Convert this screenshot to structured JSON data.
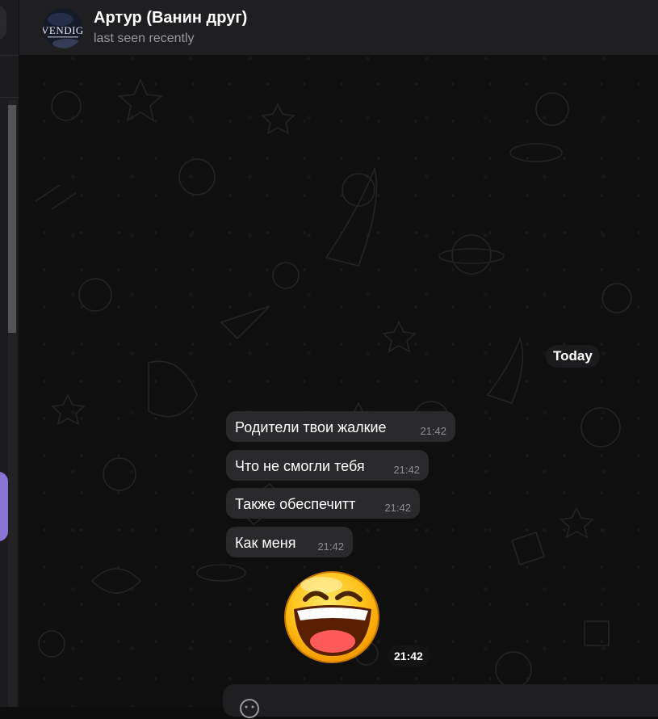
{
  "header": {
    "title": "Артур (Ванин друг)",
    "status": "last seen recently",
    "avatar_text": "VENDIGO"
  },
  "chat": {
    "date_separator": "Today",
    "messages": [
      {
        "text": "Родители твои жалкие",
        "time": "21:42"
      },
      {
        "text": "Что не смогли тебя",
        "time": "21:42"
      },
      {
        "text": "Также обеспечитт",
        "time": "21:42"
      },
      {
        "text": "Как меня",
        "time": "21:42"
      }
    ],
    "sticker": {
      "icon": "laughing-emoji-sticker",
      "time": "21:42"
    }
  },
  "composer": {
    "icon": "emoji-smile-icon"
  },
  "colors": {
    "bubble": "#2a2a2c",
    "header_bg": "#1f1f21",
    "chat_bg": "#0f0f10",
    "accent_purple": "#8a74d6"
  }
}
